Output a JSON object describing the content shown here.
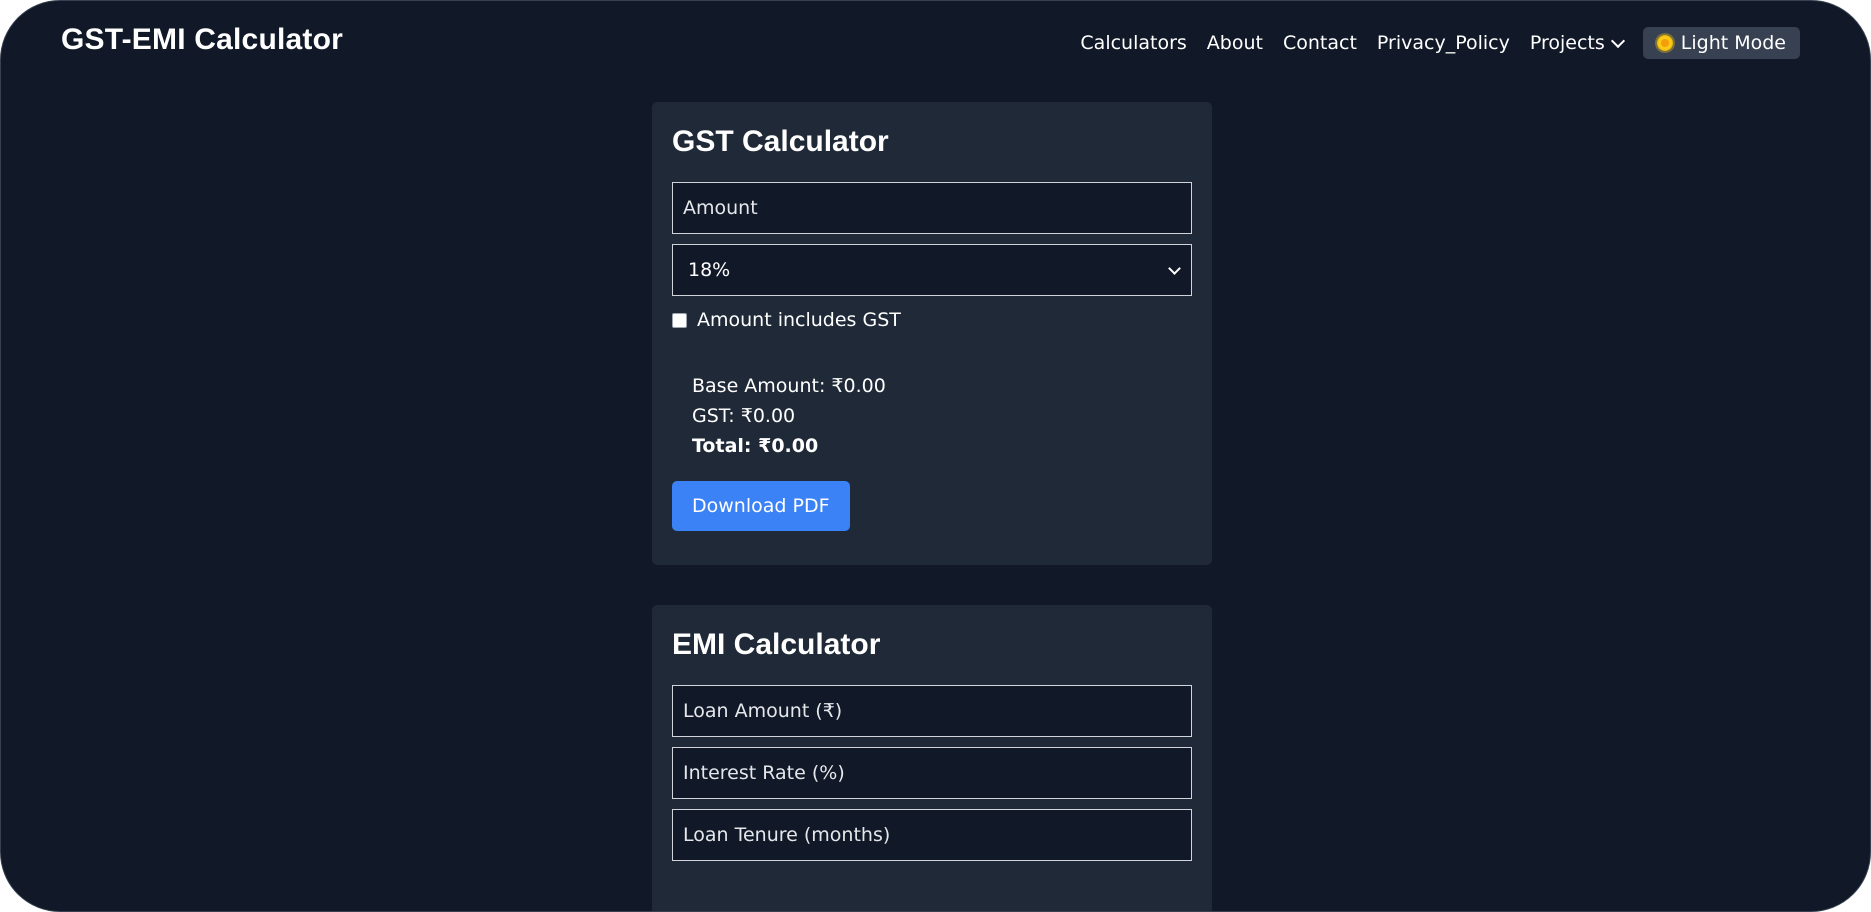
{
  "header": {
    "brand": "GST-EMI Calculator",
    "nav": {
      "calculators": "Calculators",
      "about": "About",
      "contact": "Contact",
      "privacy": "Privacy_Policy",
      "projects": "Projects",
      "theme_toggle": "Light Mode"
    },
    "icons": {
      "projects_dropdown": "chevron-down-icon",
      "theme": "sun-icon"
    }
  },
  "gst": {
    "title": "GST Calculator",
    "amount_placeholder": "Amount",
    "rate_selected": "18%",
    "includes_gst_label": "Amount includes GST",
    "includes_gst_checked": false,
    "base_amount": "Base Amount: ₹0.00",
    "gst_amount": "GST: ₹0.00",
    "total": "Total: ₹0.00",
    "download_label": "Download PDF"
  },
  "emi": {
    "title": "EMI Calculator",
    "loan_amount_placeholder": "Loan Amount (₹)",
    "interest_rate_placeholder": "Interest Rate (%)",
    "tenure_placeholder": "Loan Tenure (months)"
  },
  "colors": {
    "background": "#111827",
    "card": "#1f2937",
    "accent": "#3b82f6",
    "toggle_bg": "#374151"
  }
}
